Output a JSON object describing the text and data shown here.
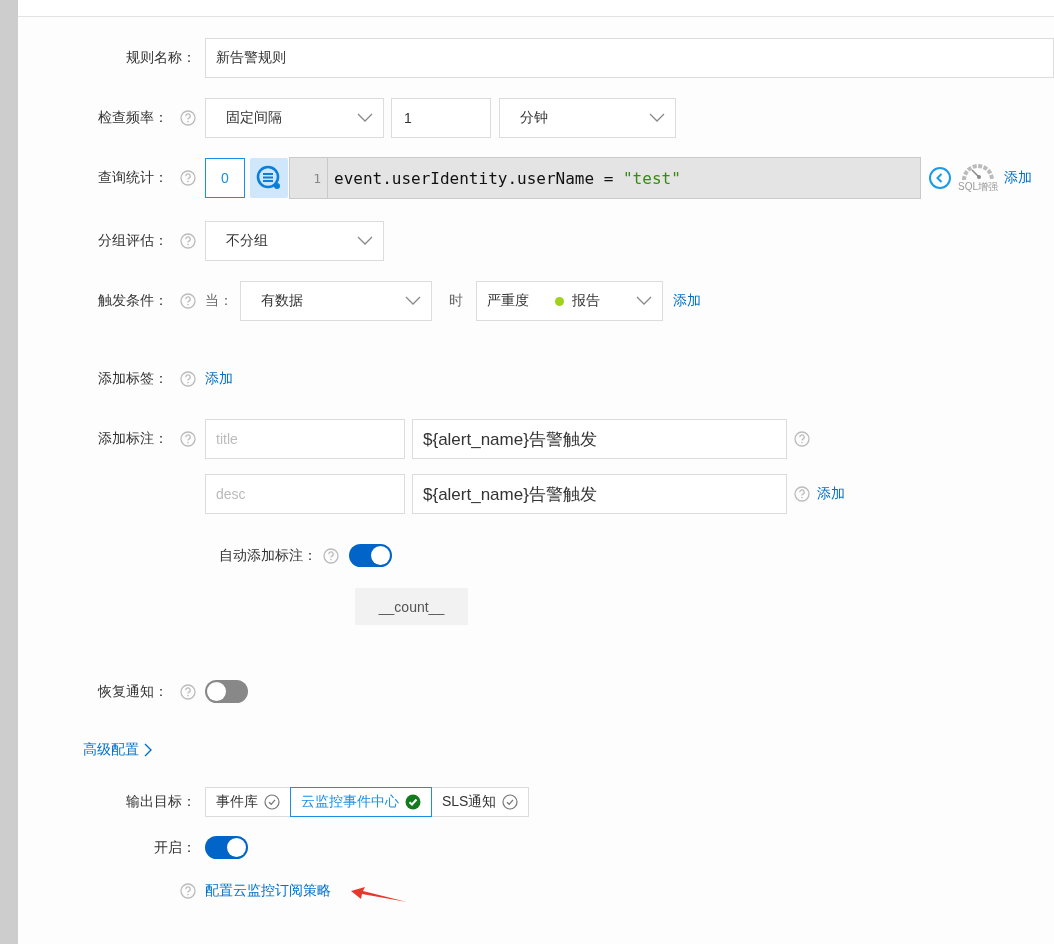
{
  "rule_name": {
    "label": "规则名称：",
    "value": "新告警规则"
  },
  "check_frequency": {
    "label": "检查频率：",
    "mode": "固定间隔",
    "interval": "1",
    "unit": "分钟"
  },
  "query": {
    "label": "查询统计：",
    "count": "0",
    "line_number": "1",
    "code": "event.userIdentity.userName = ",
    "code_string": "\"test\"",
    "sql_badge": "SQL增强",
    "add": "添加"
  },
  "grouping": {
    "label": "分组评估：",
    "value": "不分组"
  },
  "trigger": {
    "label": "触发条件：",
    "when_label": "当：",
    "condition": "有数据",
    "then_label": "时",
    "severity_label": "严重度",
    "severity": {
      "label": "报告",
      "color": "#a0d21c"
    },
    "add": "添加"
  },
  "tags": {
    "label": "添加标签：",
    "add": "添加"
  },
  "annotations": {
    "label": "添加标注：",
    "rows": [
      {
        "key_placeholder": "title",
        "value": "${alert_name}告警触发"
      },
      {
        "key_placeholder": "desc",
        "value": "${alert_name}告警触发"
      }
    ],
    "add": "添加"
  },
  "auto_annotation": {
    "label": "自动添加标注：",
    "on": true,
    "tag": "__count__"
  },
  "recovery": {
    "label": "恢复通知：",
    "on": false
  },
  "advanced": {
    "label": "高级配置"
  },
  "output": {
    "label": "输出目标：",
    "targets": [
      {
        "label": "事件库",
        "selected": false
      },
      {
        "label": "云监控事件中心",
        "selected": true
      },
      {
        "label": "SLS通知",
        "selected": false
      }
    ]
  },
  "enable": {
    "label": "开启：",
    "on": true
  },
  "subscription": {
    "link": "配置云监控订阅策略"
  }
}
